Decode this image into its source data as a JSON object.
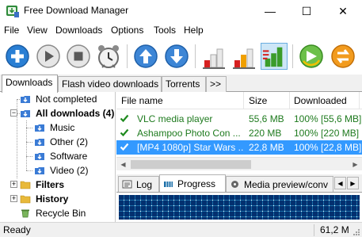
{
  "window": {
    "title": "Free Download Manager",
    "minimize_glyph": "—",
    "maximize_glyph": "☐",
    "close_glyph": "✕"
  },
  "menu": [
    "File",
    "View",
    "Downloads",
    "Options",
    "Tools",
    "Help"
  ],
  "toolbar": {
    "buttons": [
      "add-icon",
      "start-icon",
      "stop-icon",
      "scheduler-icon",
      "move-up-icon",
      "move-down-icon",
      "speed-low-icon",
      "speed-medium-icon",
      "speed-high-icon",
      "refresh-icon",
      "switch-icon"
    ]
  },
  "tabs": [
    "Downloads",
    "Flash video downloads",
    "Torrents",
    ">>"
  ],
  "tree": {
    "not_completed": "Not completed",
    "all_downloads": "All downloads (4)",
    "music": "Music",
    "other": "Other (2)",
    "software": "Software",
    "video": "Video (2)",
    "filters": "Filters",
    "history": "History",
    "recycle_bin": "Recycle Bin"
  },
  "list": {
    "headers": [
      "File name",
      "Size",
      "Downloaded"
    ],
    "rows": [
      {
        "name": "VLC media player",
        "size": "55,6 MB",
        "downloaded": "100% [55,6 MB]",
        "state": "done"
      },
      {
        "name": "Ashampoo Photo Con ...",
        "size": "220 MB",
        "downloaded": "100% [220 MB]",
        "state": "done"
      },
      {
        "name": "[MP4 1080p] Star Wars ...",
        "size": "22,8 MB",
        "downloaded": "100% [22,8 MB]",
        "state": "selected"
      }
    ]
  },
  "bottom_tabs": [
    "Log",
    "Progress",
    "Media preview/conv"
  ],
  "bottom_nav": {
    "left": "◀",
    "right": "▶"
  },
  "status": {
    "left": "Ready",
    "right": "61,2 M"
  },
  "colors": {
    "accent_blue": "#3399ff",
    "done_green": "#1e7a1e",
    "progress_blue": "#1b6fa8"
  }
}
